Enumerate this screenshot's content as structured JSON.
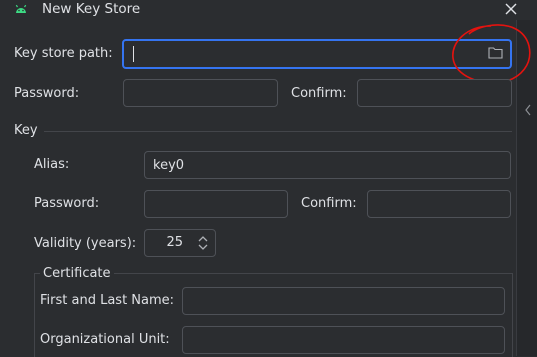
{
  "window": {
    "title": "New Key Store"
  },
  "keystore": {
    "path_label": "Key store path:",
    "path_value": "",
    "password_label": "Password:",
    "confirm_label": "Confirm:"
  },
  "key": {
    "section_label": "Key",
    "alias_label": "Alias:",
    "alias_value": "key0",
    "password_label": "Password:",
    "confirm_label": "Confirm:",
    "validity_label": "Validity (years):",
    "validity_value": "25"
  },
  "certificate": {
    "section_label": "Certificate",
    "first_last_label": "First and Last Name:",
    "org_unit_label": "Organizational Unit:"
  },
  "colors": {
    "accent": "#3574f0",
    "annotation": "#e3130f",
    "android_green": "#3ddc84"
  }
}
